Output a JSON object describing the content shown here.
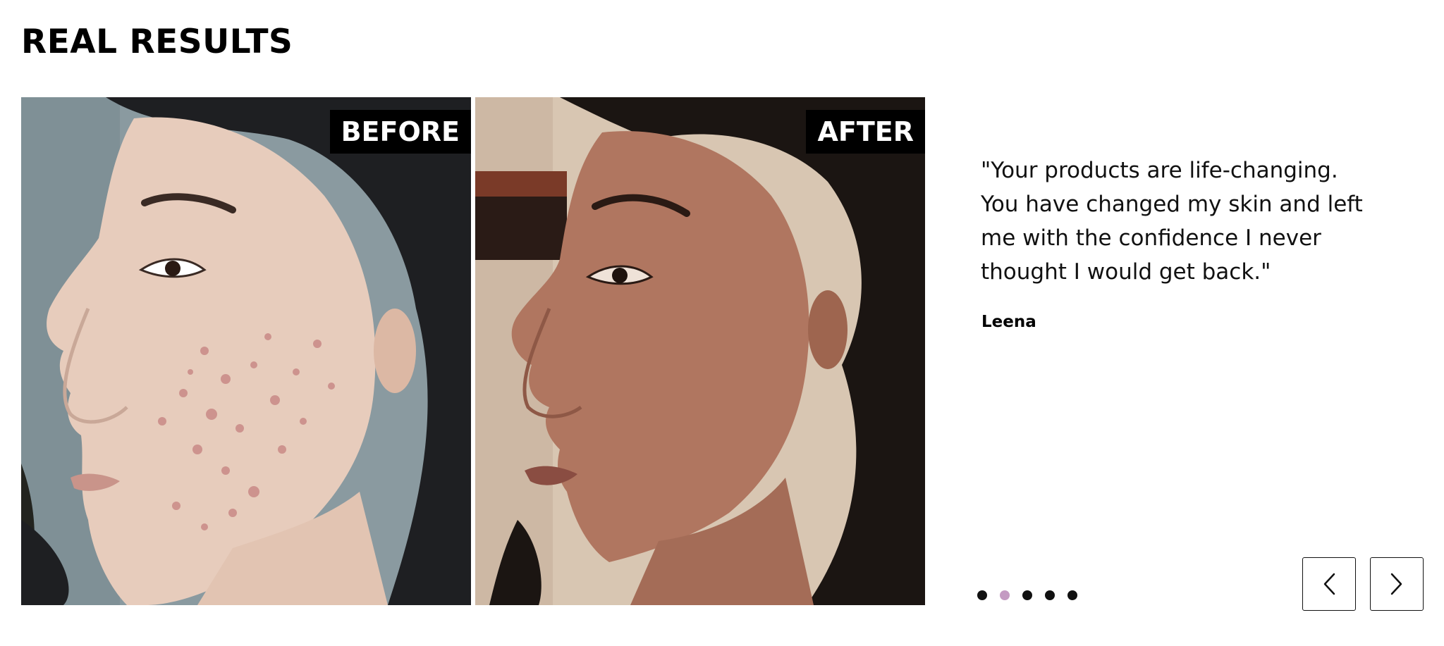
{
  "section": {
    "heading": "REAL RESULTS"
  },
  "photos": {
    "before_label": "BEFORE",
    "after_label": "AFTER"
  },
  "testimonial": {
    "quote": "\"Your products are life-changing. You have changed my skin and left me with the confidence I never thought I would get back.\"",
    "author": "Leena"
  },
  "carousel": {
    "slide_count": 5,
    "active_index": 1,
    "dot_color": "#111111",
    "active_dot_color": "#c49bc2",
    "prev_icon": "chevron-left-icon",
    "next_icon": "chevron-right-icon"
  }
}
